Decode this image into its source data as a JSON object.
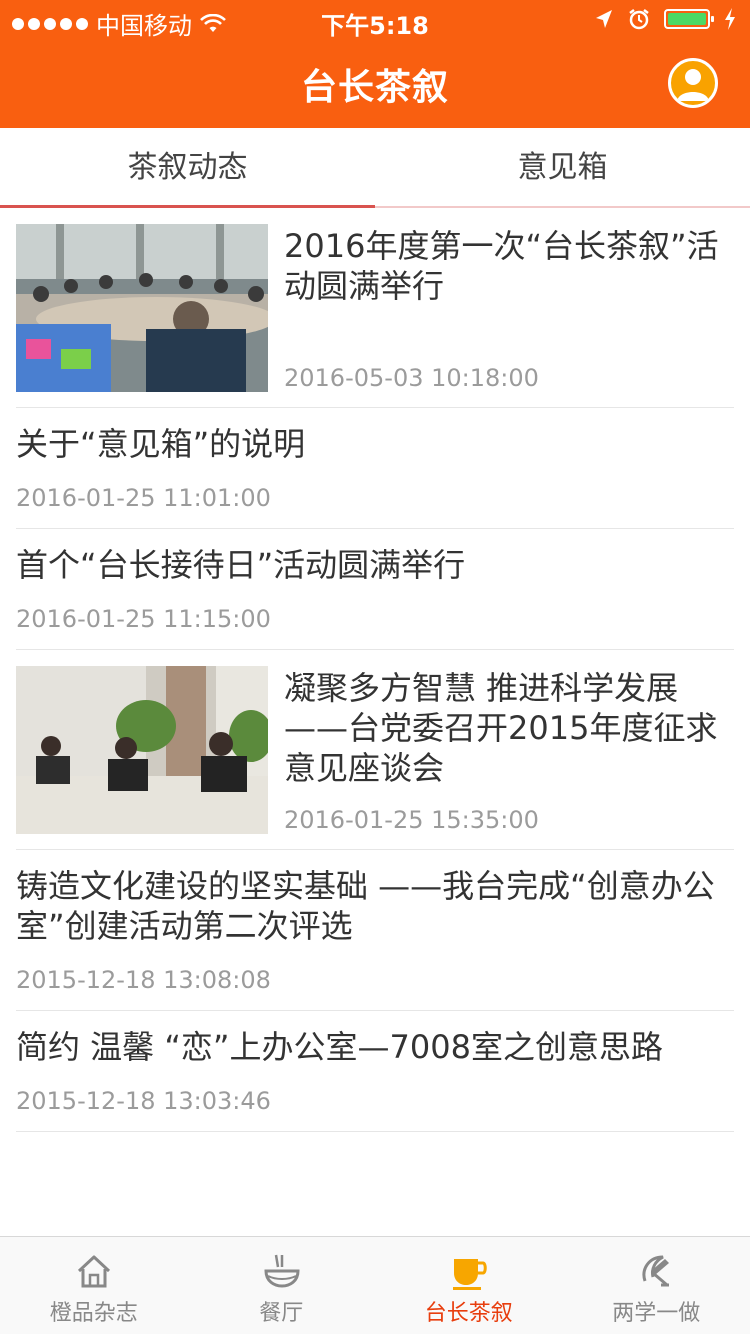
{
  "status_bar": {
    "carrier": "中国移动",
    "time": "下午5:18"
  },
  "header": {
    "title": "台长茶叙",
    "avatar_icon": "user-avatar-icon",
    "accent_color": "#f95f10"
  },
  "tabs": [
    {
      "label": "茶叙动态",
      "active": true
    },
    {
      "label": "意见箱",
      "active": false
    }
  ],
  "news": [
    {
      "title": "2016年度第一次“台长茶叙”活动圆满举行",
      "time": "2016-05-03 10:18:00",
      "has_thumb": true
    },
    {
      "title": "关于“意见箱”的说明",
      "time": "2016-01-25 11:01:00",
      "has_thumb": false
    },
    {
      "title": "首个“台长接待日”活动圆满举行",
      "time": "2016-01-25 11:15:00",
      "has_thumb": false
    },
    {
      "title": "凝聚多方智慧  推进科学发展 ——台党委召开2015年度征求意见座谈会",
      "time": "2016-01-25 15:35:00",
      "has_thumb": true
    },
    {
      "title": "铸造文化建设的坚实基础 ——我台完成“创意办公室”创建活动第二次评选",
      "time": "2015-12-18 13:08:08",
      "has_thumb": false
    },
    {
      "title": "简约 温馨 “恋”上办公室—7008室之创意思路",
      "time": "2015-12-18 13:03:46",
      "has_thumb": false
    }
  ],
  "bottom_nav": [
    {
      "label": "橙品杂志",
      "icon": "home-icon",
      "active": false
    },
    {
      "label": "餐厅",
      "icon": "bowl-icon",
      "active": false
    },
    {
      "label": "台长茶叙",
      "icon": "tea-cup-icon",
      "active": true
    },
    {
      "label": "两学一做",
      "icon": "party-emblem-icon",
      "active": false
    }
  ]
}
